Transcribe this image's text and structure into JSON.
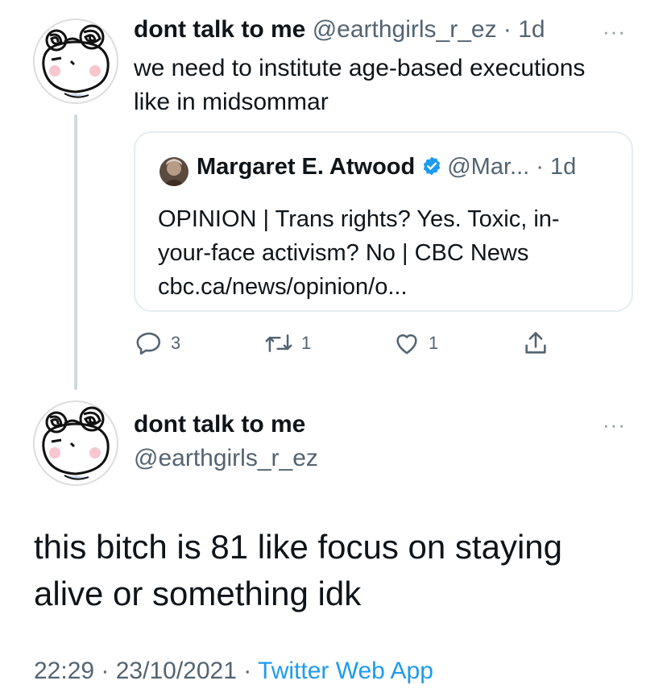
{
  "tweet1": {
    "display_name": "dont talk to me",
    "handle": "@earthgirls_r_ez",
    "separator": " · ",
    "age": "1d",
    "more": "···",
    "text_line1": "we need to institute age-based executions",
    "text_line2": "like in midsommar"
  },
  "quote": {
    "display_name": "Margaret E. Atwood",
    "handle": "@Mar...",
    "separator": " · ",
    "age": "1d",
    "text_line1": "OPINION | Trans rights? Yes. Toxic, in-",
    "text_line2": "your-face activism? No | CBC News",
    "text_line3": "cbc.ca/news/opinion/o..."
  },
  "actions": {
    "replies": "3",
    "retweets": "1",
    "likes": "1"
  },
  "tweet2": {
    "display_name": "dont talk to me",
    "handle": "@earthgirls_r_ez",
    "more": "···",
    "text_line1": "this bitch is 81 like focus on staying",
    "text_line2": "alive or something idk",
    "time": "22:29",
    "separator": " · ",
    "date": "23/10/2021",
    "separator2": " · ",
    "source": "Twitter Web App"
  },
  "colors": {
    "secondary_text": "#536471",
    "link_blue": "#1d9bf0",
    "border": "#e6ecf0",
    "thread_line": "#cfd9de"
  },
  "icons": [
    "avatar-doodle",
    "verified-badge-icon",
    "reply-icon",
    "retweet-icon",
    "like-icon",
    "share-icon",
    "more-icon"
  ]
}
